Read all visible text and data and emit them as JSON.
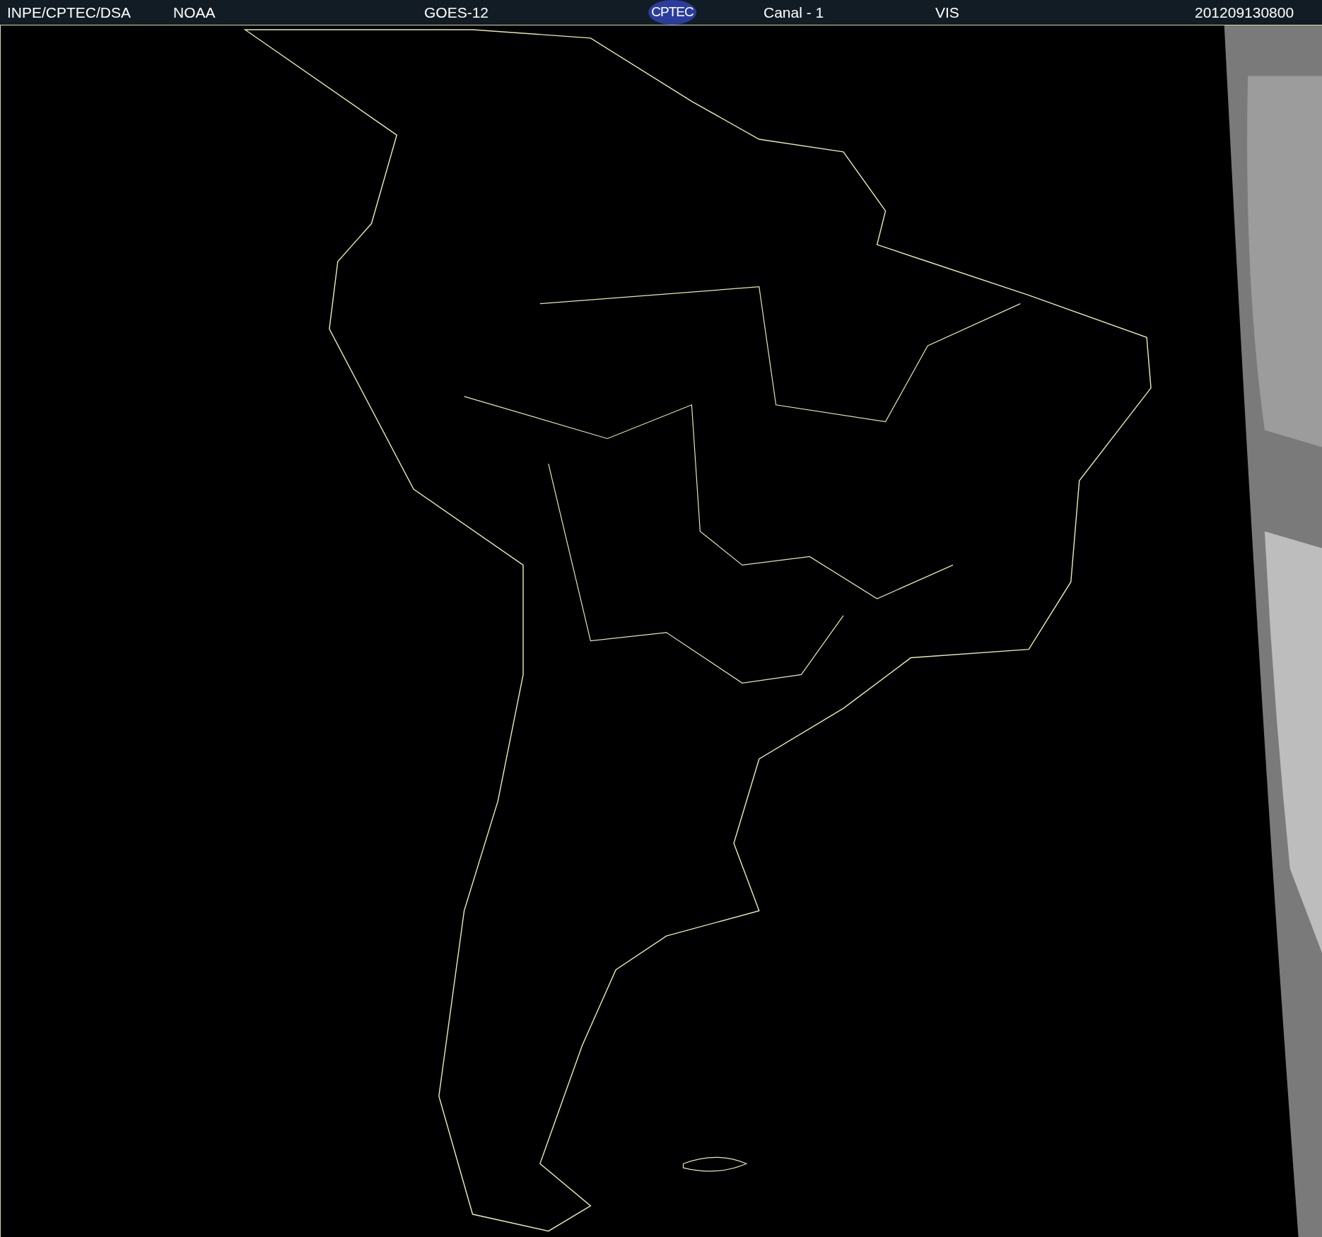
{
  "header": {
    "items": [
      {
        "kind": "text",
        "text": "INPE/CPTEC/DSA"
      },
      {
        "kind": "text",
        "text": "NOAA"
      },
      {
        "kind": "text",
        "text": "GOES-12"
      },
      {
        "kind": "logo",
        "text": "CPTEC"
      },
      {
        "kind": "text",
        "text": "Canal - 1"
      },
      {
        "kind": "text",
        "text": "VIS"
      },
      {
        "kind": "text",
        "text": "201209130800"
      }
    ]
  }
}
